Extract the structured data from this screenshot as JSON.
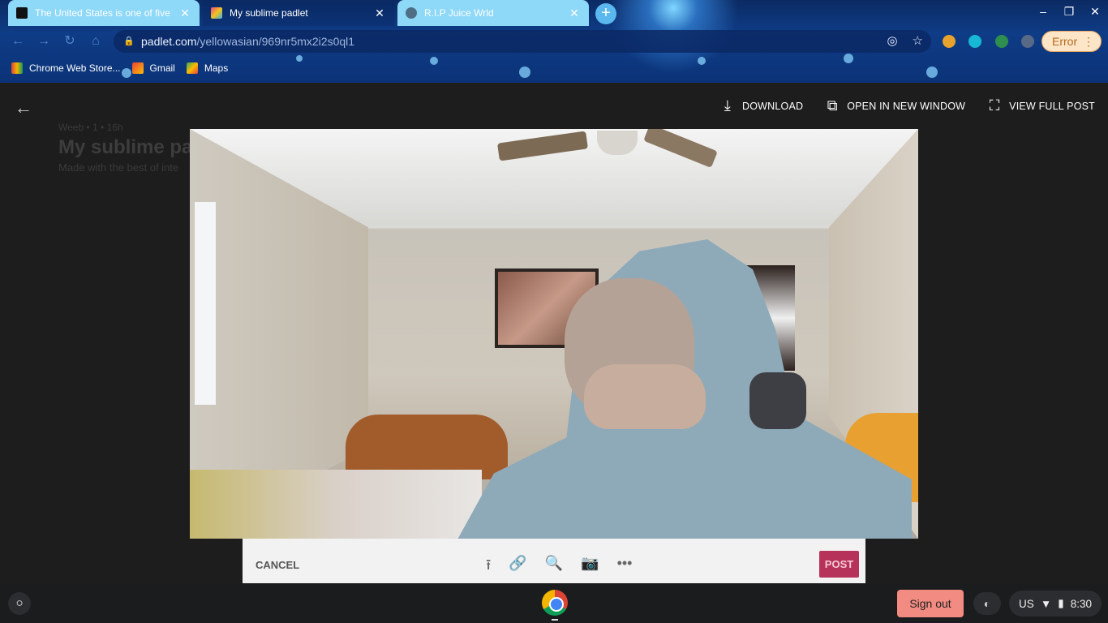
{
  "browser": {
    "tabs": [
      {
        "title": "The United States is one of five c",
        "active": false
      },
      {
        "title": "My sublime padlet",
        "active": false
      },
      {
        "title": "R.I.P Juice Wrld",
        "active": true
      }
    ],
    "new_tab_icon": "plus-icon",
    "url_host": "padlet.com",
    "url_path": "/yellowasian/969nr5mx2i2s0ql1",
    "error_label": "Error",
    "bookmarks": [
      {
        "label": "Chrome Web Store..."
      },
      {
        "label": "Gmail"
      },
      {
        "label": "Maps"
      }
    ]
  },
  "background_padlet": {
    "author_line": "Weeb  •  1  •  16h",
    "title": "My sublime pad",
    "subtitle": "Made with the best of inte"
  },
  "viewer": {
    "actions": [
      {
        "label": "DOWNLOAD",
        "icon": "download-icon"
      },
      {
        "label": "OPEN IN NEW WINDOW",
        "icon": "open-external-icon"
      },
      {
        "label": "VIEW FULL POST",
        "icon": "fullscreen-icon"
      }
    ]
  },
  "composer": {
    "cancel_label": "CANCEL",
    "post_label": "POST",
    "icons": [
      "upload-icon",
      "link-icon",
      "search-image-icon",
      "camera-icon",
      "more-icon"
    ]
  },
  "shelf": {
    "signout_label": "Sign out",
    "keyboard_layout": "US",
    "time": "8:30"
  },
  "colors": {
    "post_button": "#b7325a",
    "signout": "#f28b82",
    "tab_active": "#8ed8f8"
  }
}
